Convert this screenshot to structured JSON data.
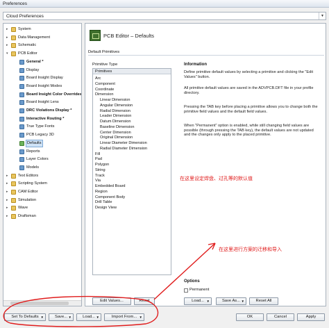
{
  "window": {
    "title": "Preferences"
  },
  "profile": {
    "value": "Cloud Preferences"
  },
  "tree": {
    "nodes": [
      {
        "label": "System",
        "level": 0,
        "icon": "folder-icon"
      },
      {
        "label": "Data Management",
        "level": 0,
        "icon": "folder-icon"
      },
      {
        "label": "Schematic",
        "level": 0,
        "icon": "folder-icon"
      },
      {
        "label": "PCB Editor",
        "level": 0,
        "icon": "folder-icon",
        "expanded": true
      },
      {
        "label": "General *",
        "level": 1,
        "icon": "item-icon",
        "bold": true
      },
      {
        "label": "Display",
        "level": 1,
        "icon": "item-icon"
      },
      {
        "label": "Board Insight Display",
        "level": 1,
        "icon": "item-icon"
      },
      {
        "label": "Board Insight Modes",
        "level": 1,
        "icon": "item-icon"
      },
      {
        "label": "Board Insight Color Overrides",
        "level": 1,
        "icon": "item-icon",
        "bold": true
      },
      {
        "label": "Board Insight Lens",
        "level": 1,
        "icon": "item-icon"
      },
      {
        "label": "DRC Violations Display *",
        "level": 1,
        "icon": "item-icon",
        "bold": true
      },
      {
        "label": "Interactive Routing *",
        "level": 1,
        "icon": "item-icon",
        "bold": true
      },
      {
        "label": "True Type Fonts",
        "level": 1,
        "icon": "item-icon"
      },
      {
        "label": "PCB Legacy 3D",
        "level": 1,
        "icon": "item-icon"
      },
      {
        "label": "Defaults",
        "level": 1,
        "icon": "green-icon",
        "selected": true
      },
      {
        "label": "Reports",
        "level": 1,
        "icon": "item-icon"
      },
      {
        "label": "Layer Colors",
        "level": 1,
        "icon": "item-icon"
      },
      {
        "label": "Models",
        "level": 1,
        "icon": "item-icon"
      },
      {
        "label": "Text Editors",
        "level": 0,
        "icon": "folder-icon"
      },
      {
        "label": "Scripting System",
        "level": 0,
        "icon": "folder-icon"
      },
      {
        "label": "CAM Editor",
        "level": 0,
        "icon": "folder-icon"
      },
      {
        "label": "Simulation",
        "level": 0,
        "icon": "folder-icon"
      },
      {
        "label": "Wave",
        "level": 0,
        "icon": "folder-icon"
      },
      {
        "label": "Draftsman",
        "level": 0,
        "icon": "folder-icon"
      }
    ]
  },
  "header": {
    "title": "PCB Editor – Defaults"
  },
  "section": {
    "title": "Default Primitives"
  },
  "primitives": {
    "type_label": "Primitive Type",
    "column_header": "Primitives",
    "items": [
      {
        "label": "Arc",
        "level": 0
      },
      {
        "label": "Component",
        "level": 0
      },
      {
        "label": "Coordinate",
        "level": 0
      },
      {
        "label": "Dimension",
        "level": 0
      },
      {
        "label": "Linear Dimension",
        "level": 1
      },
      {
        "label": "Angular Dimension",
        "level": 1
      },
      {
        "label": "Radial Dimension",
        "level": 1
      },
      {
        "label": "Leader Dimension",
        "level": 1
      },
      {
        "label": "Datum Dimension",
        "level": 1
      },
      {
        "label": "Baseline Dimension",
        "level": 1
      },
      {
        "label": "Center Dimension",
        "level": 1
      },
      {
        "label": "Original Dimension",
        "level": 1
      },
      {
        "label": "Linear Diameter Dimension",
        "level": 1
      },
      {
        "label": "Radial Diameter Dimension",
        "level": 1
      },
      {
        "label": "Fill",
        "level": 0
      },
      {
        "label": "Pad",
        "level": 0
      },
      {
        "label": "Polygon",
        "level": 0
      },
      {
        "label": "String",
        "level": 0
      },
      {
        "label": "Track",
        "level": 0
      },
      {
        "label": "Via",
        "level": 0
      },
      {
        "label": "Embedded Board",
        "level": 0
      },
      {
        "label": "Region",
        "level": 0
      },
      {
        "label": "Component Body",
        "level": 0
      },
      {
        "label": "Drill Table",
        "level": 0
      },
      {
        "label": "Design View",
        "level": 0
      }
    ]
  },
  "info": {
    "title": "Information",
    "p1": "Define primitive default values by selecting a primitive and clicking the \"Edit Values\" button.",
    "p2": "All primitive default values are saved in the ADVPCB.DFT file in your profile directory.",
    "p3": "Pressing the TAB key before placing a primitive allows you to change both the primitive field values and the default field values.",
    "p4": "When \"Permanent\" option is enabled, while still changing field values are possible (through pressing the TAB key), the default values are not updated and the changes only apply to the placed primitive."
  },
  "annotations": {
    "note1": "在这里设定焊盘、过孔等的默认值",
    "note2": "在这里进行方案的迁移和导入",
    "color": "#e01c1c"
  },
  "options": {
    "title": "Options",
    "permanent_label": "Permanent",
    "load": "Load...",
    "save_as": "Save As...",
    "reset_all": "Reset All"
  },
  "edit_values": "Edit Values...",
  "reset": "Reset",
  "bottom": {
    "set_defaults": "Set To Defaults",
    "save": "Save...",
    "load": "Load...",
    "import_from": "Import From...",
    "ok": "OK",
    "cancel": "Cancel",
    "apply": "Apply"
  }
}
